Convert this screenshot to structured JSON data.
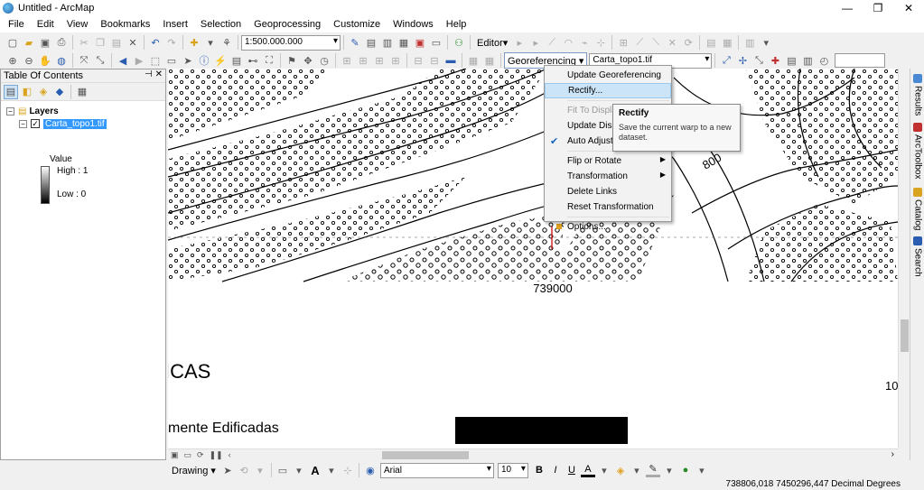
{
  "window": {
    "title": "Untitled - ArcMap",
    "minimize": "—",
    "maximize": "❐",
    "close": "✕"
  },
  "menu": [
    "File",
    "Edit",
    "View",
    "Bookmarks",
    "Insert",
    "Selection",
    "Geoprocessing",
    "Customize",
    "Windows",
    "Help"
  ],
  "standard_toolbar": {
    "scale": "1:500.000.000",
    "editor_label": "Editor▾"
  },
  "georef_toolbar": {
    "button_label": "Georeferencing ▾",
    "layer": "Carta_topo1.tif"
  },
  "toc": {
    "title": "Table Of Contents",
    "layers_label": "Layers",
    "layer_name": "Carta_topo1.tif",
    "legend_title": "Value",
    "high": "High : 1",
    "low": "Low : 0"
  },
  "georef_menu": {
    "items": [
      {
        "label": "Update Georeferencing",
        "state": "normal"
      },
      {
        "label": "Rectify...",
        "state": "highlighted"
      },
      {
        "label": "Fit To Display",
        "state": "disabled"
      },
      {
        "label": "Update Display",
        "state": "normal"
      },
      {
        "label": "Auto Adjust",
        "state": "checked"
      },
      {
        "label": "Flip or Rotate",
        "state": "submenu"
      },
      {
        "label": "Transformation",
        "state": "submenu"
      },
      {
        "label": "Delete Links",
        "state": "normal"
      },
      {
        "label": "Reset Transformation",
        "state": "normal"
      },
      {
        "label": "Options...",
        "state": "normal"
      }
    ]
  },
  "tooltip": {
    "title": "Rectify",
    "text": "Save the current warp to a new dataset."
  },
  "map_text": {
    "coord_label": "739000",
    "contour_label": "800",
    "cas_text": "ICAS",
    "edificadas_text": "mente Edificadas",
    "ten": "10"
  },
  "dock_tabs": [
    "Results",
    "ArcToolbox",
    "Catalog",
    "Search"
  ],
  "draw_toolbar": {
    "drawing": "Drawing ▾",
    "font": "Arial",
    "size": "10",
    "bold": "B",
    "italic": "I",
    "underline": "U",
    "text_tool": "A"
  },
  "status": {
    "coordinates": "738806,018  7450296,447 Decimal Degrees"
  }
}
